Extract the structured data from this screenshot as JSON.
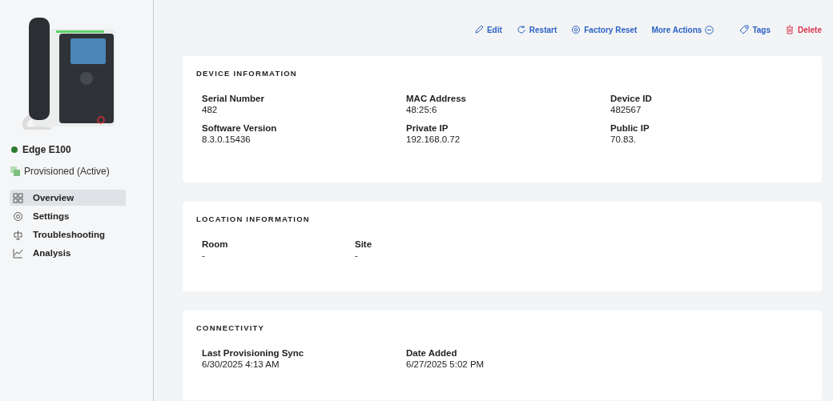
{
  "device": {
    "name": "Edge E100",
    "online": true,
    "provisioning": "Provisioned (Active)"
  },
  "nav": [
    {
      "label": "Overview",
      "selected": true
    },
    {
      "label": "Settings",
      "selected": false
    },
    {
      "label": "Troubleshooting",
      "selected": false
    },
    {
      "label": "Analysis",
      "selected": false
    }
  ],
  "actions": [
    {
      "label": "Edit",
      "kind": "normal"
    },
    {
      "label": "Restart",
      "kind": "normal"
    },
    {
      "label": "Factory Reset",
      "kind": "normal"
    },
    {
      "label": "More Actions",
      "kind": "normal"
    },
    {
      "label": "Tags",
      "kind": "normal"
    },
    {
      "label": "Delete",
      "kind": "danger"
    }
  ],
  "sections": [
    {
      "title": "DEVICE INFORMATION",
      "fields": [
        {
          "label": "Serial Number",
          "value": "482"
        },
        {
          "label": "MAC Address",
          "value": "48:25:6"
        },
        {
          "label": "Device ID",
          "value": "482567"
        },
        {
          "label": "Software Version",
          "value": "8.3.0.15436"
        },
        {
          "label": "Private IP",
          "value": "192.168.0.72"
        },
        {
          "label": "Public IP",
          "value": "70.83."
        }
      ]
    },
    {
      "title": "LOCATION INFORMATION",
      "fields": [
        {
          "label": "Room",
          "value": "-"
        },
        {
          "label": "Site",
          "value": "-"
        }
      ]
    },
    {
      "title": "CONNECTIVITY",
      "fields": [
        {
          "label": "Last Provisioning Sync",
          "value": "6/30/2025 4:13 AM"
        },
        {
          "label": "Date Added",
          "value": "6/27/2025 5:02 PM"
        }
      ]
    }
  ]
}
